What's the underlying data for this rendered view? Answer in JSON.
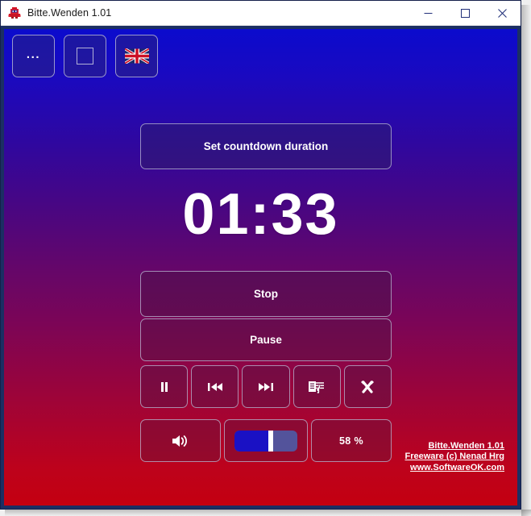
{
  "window": {
    "title": "Bitte.Wenden 1.01",
    "app_icon": "robot-icon",
    "controls": {
      "minimize": "minimize-icon",
      "maximize": "maximize-icon",
      "close": "close-icon"
    }
  },
  "toolbar": {
    "buttons": [
      {
        "name": "more-options-button",
        "label": "...",
        "icon": "ellipsis-icon"
      },
      {
        "name": "always-on-top-button",
        "label": "",
        "icon": "square-icon"
      },
      {
        "name": "language-button",
        "label": "",
        "icon": "uk-flag-icon"
      }
    ]
  },
  "main": {
    "set_duration_label": "Set countdown duration",
    "countdown": "01:33",
    "stop_label": "Stop",
    "pause_label": "Pause",
    "media_buttons": [
      {
        "name": "pause-icon-button",
        "icon": "pause-icon"
      },
      {
        "name": "previous-icon-button",
        "icon": "skip-backward-icon"
      },
      {
        "name": "next-icon-button",
        "icon": "skip-forward-icon"
      },
      {
        "name": "sound-select-icon-button",
        "icon": "music-note-icon"
      },
      {
        "name": "settings-icon-button",
        "icon": "tools-icon"
      }
    ],
    "volume": {
      "mute_icon": "speaker-icon",
      "percent_label": "58 %",
      "percent_value": 58
    }
  },
  "footer": {
    "line1": "Bitte.Wenden 1.01",
    "line2": "Freeware (c) Nenad Hrg",
    "line3": "www.SoftwareOK.com"
  },
  "colors": {
    "gradient_top": "#0b0bcd",
    "gradient_bottom": "#c40010",
    "frame": "#1b2f63",
    "slider_fill": "#1a11c4",
    "slider_track": "#53539b"
  }
}
